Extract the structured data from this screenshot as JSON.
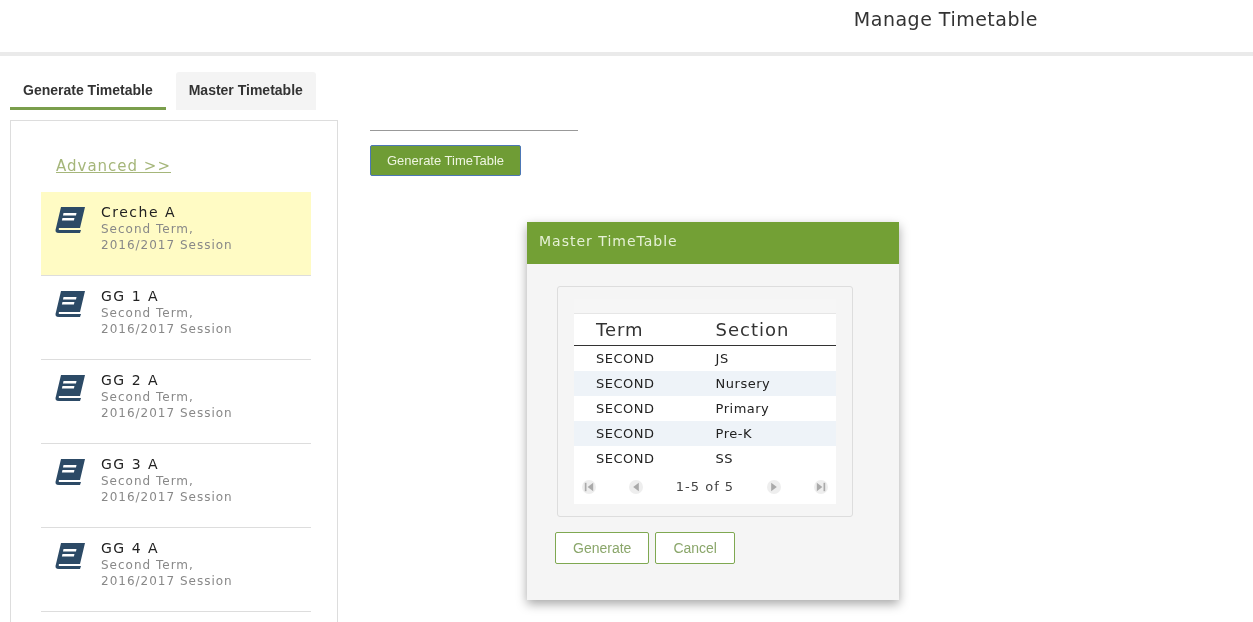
{
  "header": {
    "title": "Manage Timetable"
  },
  "tabs": [
    {
      "label": "Generate Timetable",
      "selected": true
    },
    {
      "label": "Master Timetable",
      "selected": false
    }
  ],
  "sidebar": {
    "link": "Advanced >>",
    "items": [
      {
        "name": "Creche A",
        "term": "Second Term,",
        "session": "2016/2017 Session",
        "selected": true
      },
      {
        "name": "GG 1 A",
        "term": "Second Term,",
        "session": "2016/2017 Session",
        "selected": false
      },
      {
        "name": "GG 2 A",
        "term": "Second Term,",
        "session": "2016/2017 Session",
        "selected": false
      },
      {
        "name": "GG 3 A",
        "term": "Second Term,",
        "session": "2016/2017 Session",
        "selected": false
      },
      {
        "name": "GG 4 A",
        "term": "Second Term,",
        "session": "2016/2017 Session",
        "selected": false
      }
    ]
  },
  "generate_button": "Generate TimeTable",
  "dialog": {
    "title": "Master TimeTable",
    "table": {
      "columns": [
        "Term",
        "Section"
      ],
      "rows": [
        [
          "SECOND",
          "JS"
        ],
        [
          "SECOND",
          "Nursery"
        ],
        [
          "SECOND",
          "Primary"
        ],
        [
          "SECOND",
          "Pre-K"
        ],
        [
          "SECOND",
          "SS"
        ]
      ]
    },
    "pager": "1-5 of 5",
    "buttons": [
      "Generate",
      "Cancel"
    ]
  }
}
